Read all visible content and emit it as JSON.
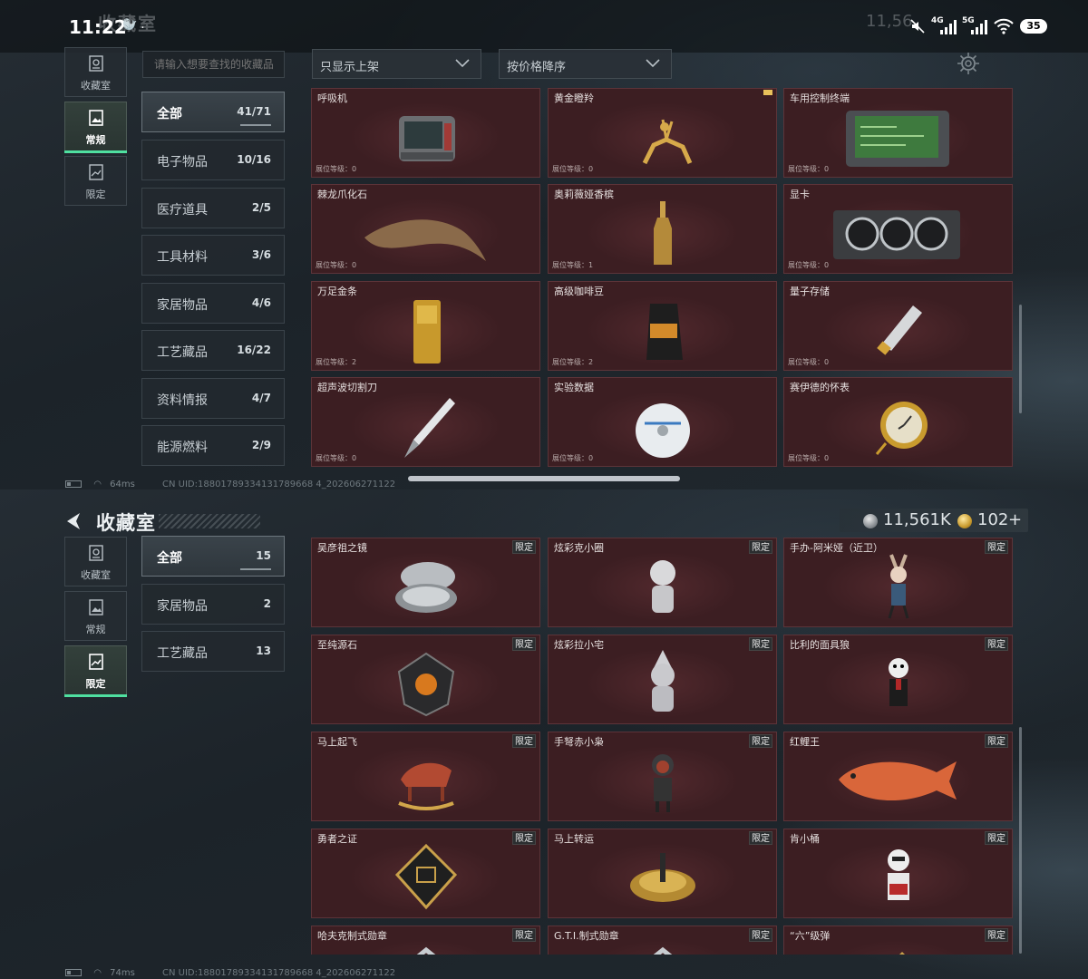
{
  "status_bar": {
    "time": "11:22",
    "extra": "🦭 .",
    "ghost_title": "收藏室",
    "ghost_currency": "11,56",
    "network_1": "4G",
    "network_2": "5G",
    "battery": "35"
  },
  "top": {
    "header": {
      "title": "收藏室"
    },
    "side_tabs": [
      {
        "label": "收藏室",
        "icon": "collection-icon"
      },
      {
        "label": "常规",
        "icon": "picture-icon"
      },
      {
        "label": "限定",
        "icon": "limited-icon"
      }
    ],
    "search": {
      "placeholder": "请输入想要查找的收藏品"
    },
    "filter1": "只显示上架",
    "filter2": "按价格降序",
    "categories": [
      {
        "name": "全部",
        "count": "41/71"
      },
      {
        "name": "电子物品",
        "count": "10/16"
      },
      {
        "name": "医疗道具",
        "count": "2/5"
      },
      {
        "name": "工具材料",
        "count": "3/6"
      },
      {
        "name": "家居物品",
        "count": "4/6"
      },
      {
        "name": "工艺藏品",
        "count": "16/22"
      },
      {
        "name": "资料情报",
        "count": "4/7"
      },
      {
        "name": "能源燃料",
        "count": "2/9"
      }
    ],
    "items": [
      {
        "name": "呼吸机",
        "level": "展位等级：0"
      },
      {
        "name": "黄金瞪羚",
        "level": "展位等级：0"
      },
      {
        "name": "车用控制终端",
        "level": "展位等级：0"
      },
      {
        "name": "棘龙爪化石",
        "level": "展位等级：0"
      },
      {
        "name": "奥莉薇娅香槟",
        "level": "展位等级：1"
      },
      {
        "name": "显卡",
        "level": "展位等级：0"
      },
      {
        "name": "万足金条",
        "level": "展位等级：2"
      },
      {
        "name": "高级咖啡豆",
        "level": "展位等级：2"
      },
      {
        "name": "量子存储",
        "level": "展位等级：0"
      },
      {
        "name": "超声波切割刀",
        "level": "展位等级：0"
      },
      {
        "name": "实验数据",
        "level": "展位等级：0"
      },
      {
        "name": "赛伊德的怀表",
        "level": "展位等级：0"
      }
    ],
    "footer": {
      "ping": "64ms",
      "uid": "CN UID:18801789334131789668 4_202606271122"
    }
  },
  "bottom": {
    "header": {
      "title": "收藏室"
    },
    "currency": {
      "silver": "11,561K",
      "gold": "102",
      "plus": "+"
    },
    "side_tabs": [
      {
        "label": "收藏室",
        "icon": "collection-icon"
      },
      {
        "label": "常规",
        "icon": "picture-icon"
      },
      {
        "label": "限定",
        "icon": "limited-icon"
      }
    ],
    "categories": [
      {
        "name": "全部",
        "count": "15"
      },
      {
        "name": "家居物品",
        "count": "2"
      },
      {
        "name": "工艺藏品",
        "count": "13"
      }
    ],
    "limited_badge": "限定",
    "items": [
      {
        "name": "吴彦祖之镜"
      },
      {
        "name": "炫彩克小圈"
      },
      {
        "name": "手办-阿米娅（近卫）"
      },
      {
        "name": "至纯源石"
      },
      {
        "name": "炫彩拉小宅"
      },
      {
        "name": "比利的面具狼"
      },
      {
        "name": "马上起飞"
      },
      {
        "name": "手弩赤小枭"
      },
      {
        "name": "红鲤王"
      },
      {
        "name": "勇者之证"
      },
      {
        "name": "马上转运"
      },
      {
        "name": "肯小桶"
      },
      {
        "name": "哈夫克制式勋章"
      },
      {
        "name": "G.T.I.制式勋章"
      },
      {
        "name": "“六”级弹"
      }
    ],
    "footer": {
      "ping": "74ms",
      "uid": "CN UID:18801789334131789668 4_202606271122"
    }
  }
}
